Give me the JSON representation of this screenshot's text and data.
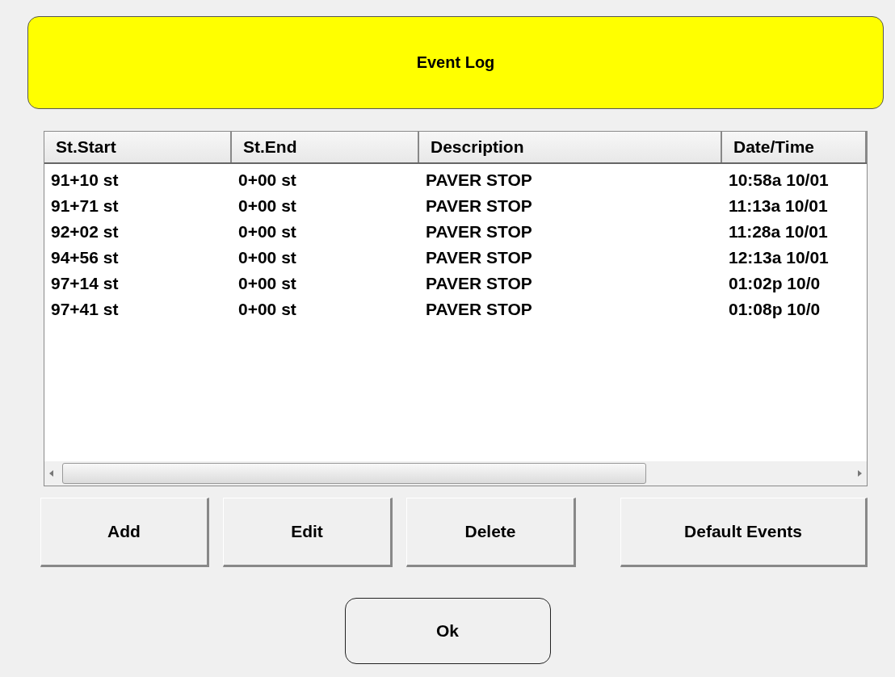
{
  "title": "Event Log",
  "table": {
    "columns": [
      "St.Start",
      "St.End",
      "Description",
      "Date/Time"
    ],
    "rows": [
      [
        "91+10 st",
        "0+00 st",
        "PAVER STOP",
        "10:58a 10/01"
      ],
      [
        "91+71 st",
        "0+00 st",
        "PAVER STOP",
        "11:13a 10/01"
      ],
      [
        "92+02 st",
        "0+00 st",
        "PAVER STOP",
        "11:28a 10/01"
      ],
      [
        "94+56 st",
        "0+00 st",
        "PAVER STOP",
        "12:13a 10/01"
      ],
      [
        "97+14 st",
        "0+00 st",
        "PAVER STOP",
        "01:02p 10/0"
      ],
      [
        "97+41 st",
        "0+00 st",
        "PAVER STOP",
        "01:08p 10/0"
      ]
    ]
  },
  "buttons": [
    "Add",
    "Edit",
    "Delete",
    "Default Events"
  ],
  "ok_button": "Ok"
}
